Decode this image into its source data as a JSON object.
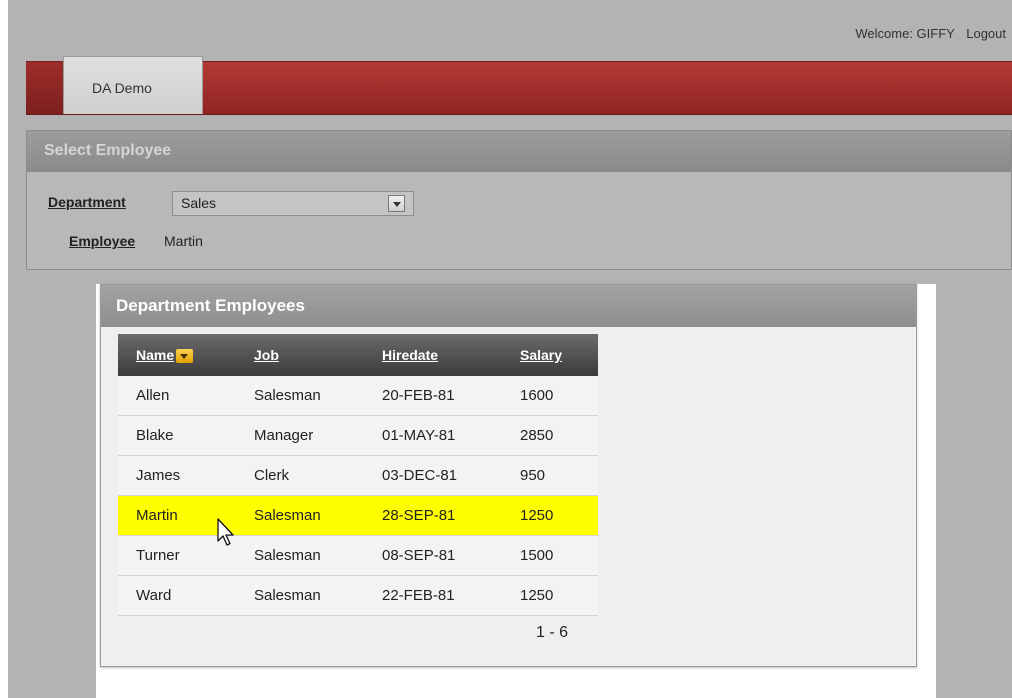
{
  "header": {
    "welcome": "Welcome: GIFFY",
    "logout_label": "Logout"
  },
  "tabs": [
    {
      "label": "DA Demo",
      "active": true
    }
  ],
  "select_region": {
    "title": "Select Employee",
    "department_label": "Department",
    "department_value": "Sales",
    "employee_label": "Employee",
    "employee_value": "Martin"
  },
  "report_region": {
    "title": "Department Employees",
    "columns": [
      "Name",
      "Job",
      "Hiredate",
      "Salary"
    ],
    "rows": [
      [
        "Allen",
        "Salesman",
        "20-FEB-81",
        "1600"
      ],
      [
        "Blake",
        "Manager",
        "01-MAY-81",
        "2850"
      ],
      [
        "James",
        "Clerk",
        "03-DEC-81",
        "950"
      ],
      [
        "Martin",
        "Salesman",
        "28-SEP-81",
        "1250"
      ],
      [
        "Turner",
        "Salesman",
        "08-SEP-81",
        "1500"
      ],
      [
        "Ward",
        "Salesman",
        "22-FEB-81",
        "1250"
      ]
    ],
    "highlighted_row_index": 3,
    "highlight_color": "#ffff00",
    "pagination": "1 - 6"
  },
  "colors": {
    "tab_bar": "#a32f2c",
    "accent_sort": "#f0b400"
  },
  "icons": {
    "sort": "chevron-down-icon",
    "select": "chevron-down-icon",
    "cursor": "mouse-pointer-icon"
  }
}
